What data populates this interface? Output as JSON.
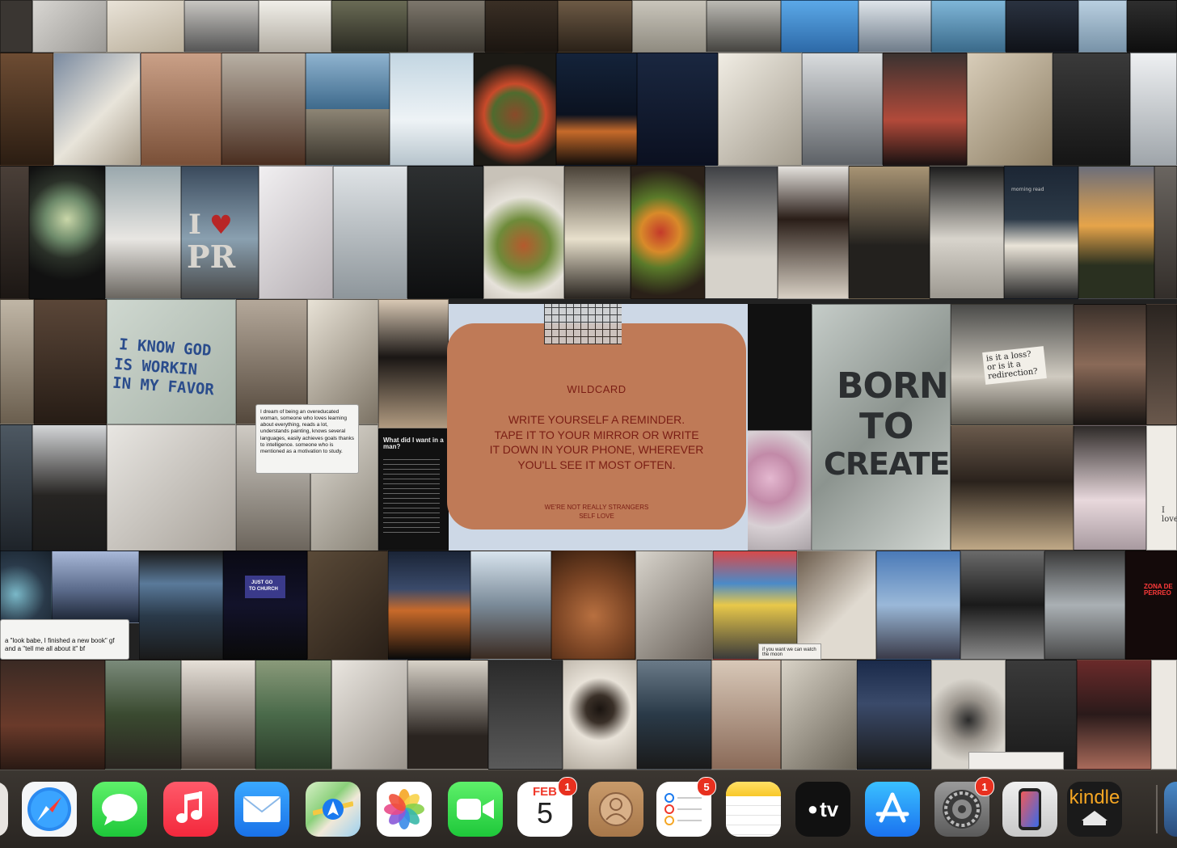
{
  "wallpaper": {
    "wildcard": {
      "title": "WILDCARD",
      "line1": "WRITE YOURSELF A REMINDER.",
      "line2": "TAPE IT TO YOUR MIRROR OR WRITE",
      "line3": "IT DOWN IN YOUR PHONE, WHEREVER",
      "line4": "YOU'LL SEE IT MOST OFTEN.",
      "footer1": "WE'RE NOT REALLY STRANGERS",
      "footer2": "SELF LOVE"
    },
    "texts": {
      "i_love_pr_i": "I",
      "i_love_pr_heart": "♥",
      "i_love_pr_pr": "PR",
      "graffiti_1": "I KNOW GOD",
      "graffiti_2": "IS WORKIN",
      "graffiti_3": "IN MY FAVOR",
      "born_1": "BORN",
      "born_2": "TO",
      "born_3": "CREATE",
      "loss_1": "is it a loss?",
      "loss_2": "or is it a",
      "loss_3": "redirection?",
      "church_1": "JUST GO",
      "church_2": "TO CHURCH",
      "tweet_overeducated": "I dream of being an overeducated woman, someone who loves learning about everything, reads a lot, understands painting, knows several languages, easily achieves goals thanks to intelligence. someone who is mentioned as a motivation to study.",
      "tweet_book": "a \"look babe, I finished a new book\" gf and a \"tell me all about it\" bf",
      "note_title": "What did I want in a man?",
      "note_watch": "if you want we can watch the moon",
      "i_love": "I love",
      "zona": "ZONA DE PERREO",
      "morning": "morning read"
    }
  },
  "dock": {
    "apps": [
      {
        "name": "Safari"
      },
      {
        "name": "Messages"
      },
      {
        "name": "Music"
      },
      {
        "name": "Mail"
      },
      {
        "name": "Maps"
      },
      {
        "name": "Photos"
      },
      {
        "name": "FaceTime"
      },
      {
        "name": "Calendar",
        "month": "FEB",
        "day": "5",
        "badge": "1"
      },
      {
        "name": "Contacts"
      },
      {
        "name": "Reminders",
        "badge": "5"
      },
      {
        "name": "Notes"
      },
      {
        "name": "TV",
        "label": "tv"
      },
      {
        "name": "App Store"
      },
      {
        "name": "System Settings",
        "badge": "1"
      },
      {
        "name": "iPhone Mirroring"
      },
      {
        "name": "Kindle",
        "label": "kindle"
      }
    ]
  },
  "colors": {
    "wildcard_card": "#bf7a57",
    "wildcard_text": "#7a1d14",
    "badge": "#e8301f"
  }
}
